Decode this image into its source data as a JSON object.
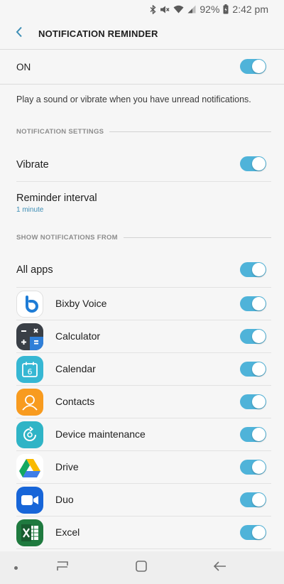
{
  "status_bar": {
    "battery_percent": "92%",
    "time": "2:42 pm"
  },
  "header": {
    "title": "NOTIFICATION REMINDER"
  },
  "master": {
    "label": "ON",
    "enabled": true
  },
  "description": "Play a sound or vibrate when you have unread notifications.",
  "notification_settings": {
    "header": "NOTIFICATION SETTINGS",
    "vibrate_label": "Vibrate",
    "vibrate_enabled": true,
    "interval_label": "Reminder interval",
    "interval_value": "1 minute"
  },
  "show_from": {
    "header": "SHOW NOTIFICATIONS FROM",
    "all_apps_label": "All apps",
    "all_apps_enabled": true,
    "apps": [
      {
        "name": "Bixby Voice",
        "icon": "bixby-icon",
        "enabled": true
      },
      {
        "name": "Calculator",
        "icon": "calculator-icon",
        "enabled": true
      },
      {
        "name": "Calendar",
        "icon": "calendar-icon",
        "enabled": true
      },
      {
        "name": "Contacts",
        "icon": "contacts-icon",
        "enabled": true
      },
      {
        "name": "Device maintenance",
        "icon": "device-maintenance-icon",
        "enabled": true
      },
      {
        "name": "Drive",
        "icon": "drive-icon",
        "enabled": true
      },
      {
        "name": "Duo",
        "icon": "duo-icon",
        "enabled": true
      },
      {
        "name": "Excel",
        "icon": "excel-icon",
        "enabled": true
      }
    ]
  },
  "calendar_icon_day": "6",
  "colors": {
    "accent": "#4fb3d9",
    "link": "#3d8eb5",
    "background": "#f6f6f6"
  }
}
